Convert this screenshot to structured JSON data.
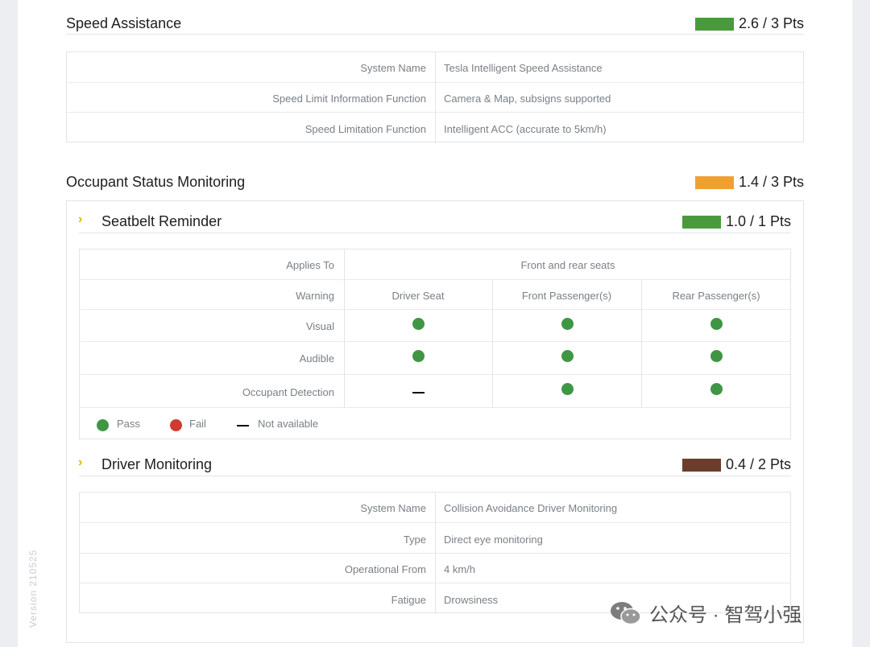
{
  "speed_assistance": {
    "title": "Speed Assistance",
    "score": "2.6 / 3 Pts",
    "score_color": "#4a9a3d",
    "rows": [
      {
        "label": "System Name",
        "value": "Tesla Intelligent Speed Assistance"
      },
      {
        "label": "Speed Limit Information Function",
        "value": "Camera & Map, subsigns supported"
      },
      {
        "label": "Speed Limitation Function",
        "value": "Intelligent ACC (accurate to 5km/h)"
      }
    ]
  },
  "occupant_status": {
    "title": "Occupant Status Monitoring",
    "score": "1.4 / 3 Pts",
    "score_color": "#f0a030"
  },
  "seatbelt": {
    "title": "Seatbelt Reminder",
    "score": "1.0 / 1 Pts",
    "score_color": "#4a9a3d",
    "applies_to_label": "Applies To",
    "applies_to_value": "Front and rear seats",
    "warning_label": "Warning",
    "columns": [
      "Driver Seat",
      "Front Passenger(s)",
      "Rear Passenger(s)"
    ],
    "rows": [
      {
        "label": "Visual",
        "cells": [
          "pass",
          "pass",
          "pass"
        ]
      },
      {
        "label": "Audible",
        "cells": [
          "pass",
          "pass",
          "pass"
        ]
      },
      {
        "label": "Occupant Detection",
        "cells": [
          "na",
          "pass",
          "pass"
        ]
      }
    ],
    "legend": {
      "pass": "Pass",
      "fail": "Fail",
      "na": "Not available"
    },
    "colors": {
      "pass": "#3f9645",
      "fail": "#d03a2f"
    }
  },
  "driver_monitoring": {
    "title": "Driver Monitoring",
    "score": "0.4 / 2 Pts",
    "score_color": "#6b3d2a",
    "rows": [
      {
        "label": "System Name",
        "value": "Collision Avoidance Driver Monitoring"
      },
      {
        "label": "Type",
        "value": "Direct eye monitoring"
      },
      {
        "label": "Operational From",
        "value": "4 km/h"
      },
      {
        "label": "Fatigue",
        "value": "Drowsiness"
      }
    ]
  },
  "version": "Version 210525",
  "watermark": {
    "text": "公众号 · 智驾小强",
    "icon": "wechat-icon"
  }
}
